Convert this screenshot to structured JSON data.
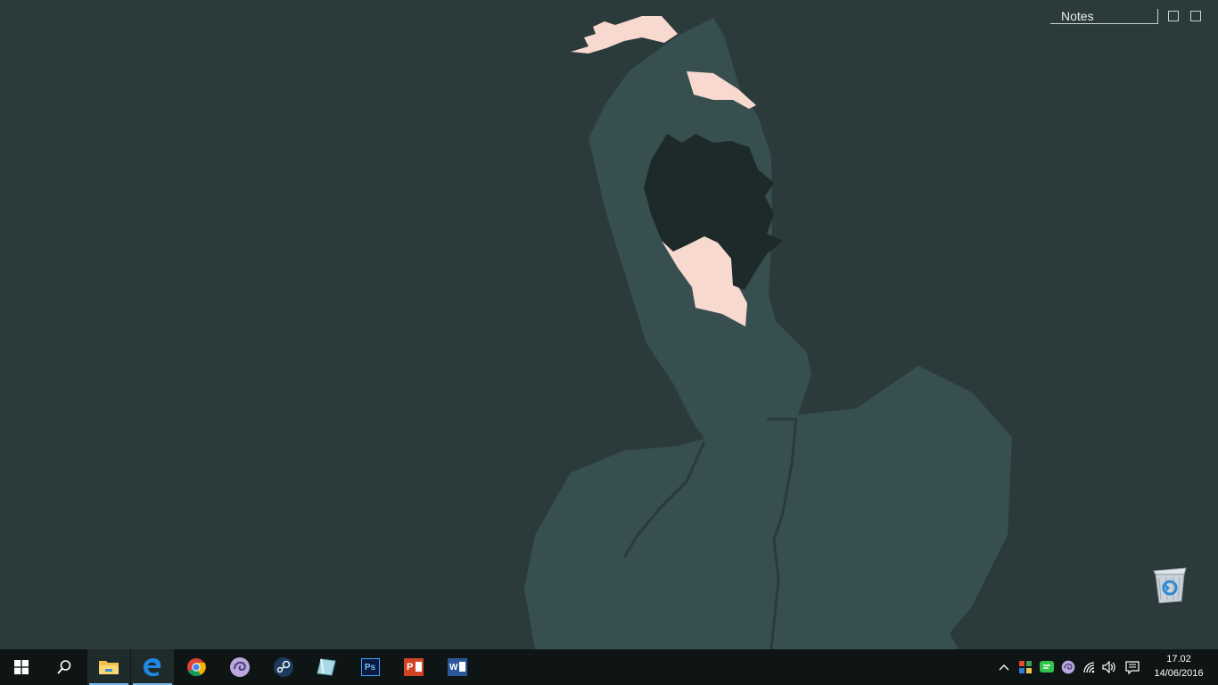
{
  "notes": {
    "title": "Notes"
  },
  "taskbar": {
    "apps": [
      {
        "name": "File Explorer",
        "icon": "folder-icon"
      },
      {
        "name": "Microsoft Edge",
        "icon": "edge-icon"
      },
      {
        "name": "Google Chrome",
        "icon": "chrome-icon"
      },
      {
        "name": "BitTorrent",
        "icon": "bittorrent-icon"
      },
      {
        "name": "Steam",
        "icon": "steam-icon"
      },
      {
        "name": "Notes app",
        "icon": "notes-app-icon"
      },
      {
        "name": "Adobe Photoshop",
        "icon": "photoshop-icon"
      },
      {
        "name": "PowerPoint",
        "icon": "powerpoint-icon"
      },
      {
        "name": "Word",
        "icon": "word-icon"
      }
    ],
    "photoshop_label": "Ps",
    "powerpoint_label": "P",
    "word_label": "W"
  },
  "clock": {
    "time": "17.02",
    "date": "14/06/2016"
  },
  "colors": {
    "wallpaper": "#2b3a3a",
    "figure": "#37504f",
    "skin": "#f8d9cf",
    "hair": "#1e2a2a",
    "taskbar": "#0f1515",
    "accent": "#76b9ed"
  }
}
